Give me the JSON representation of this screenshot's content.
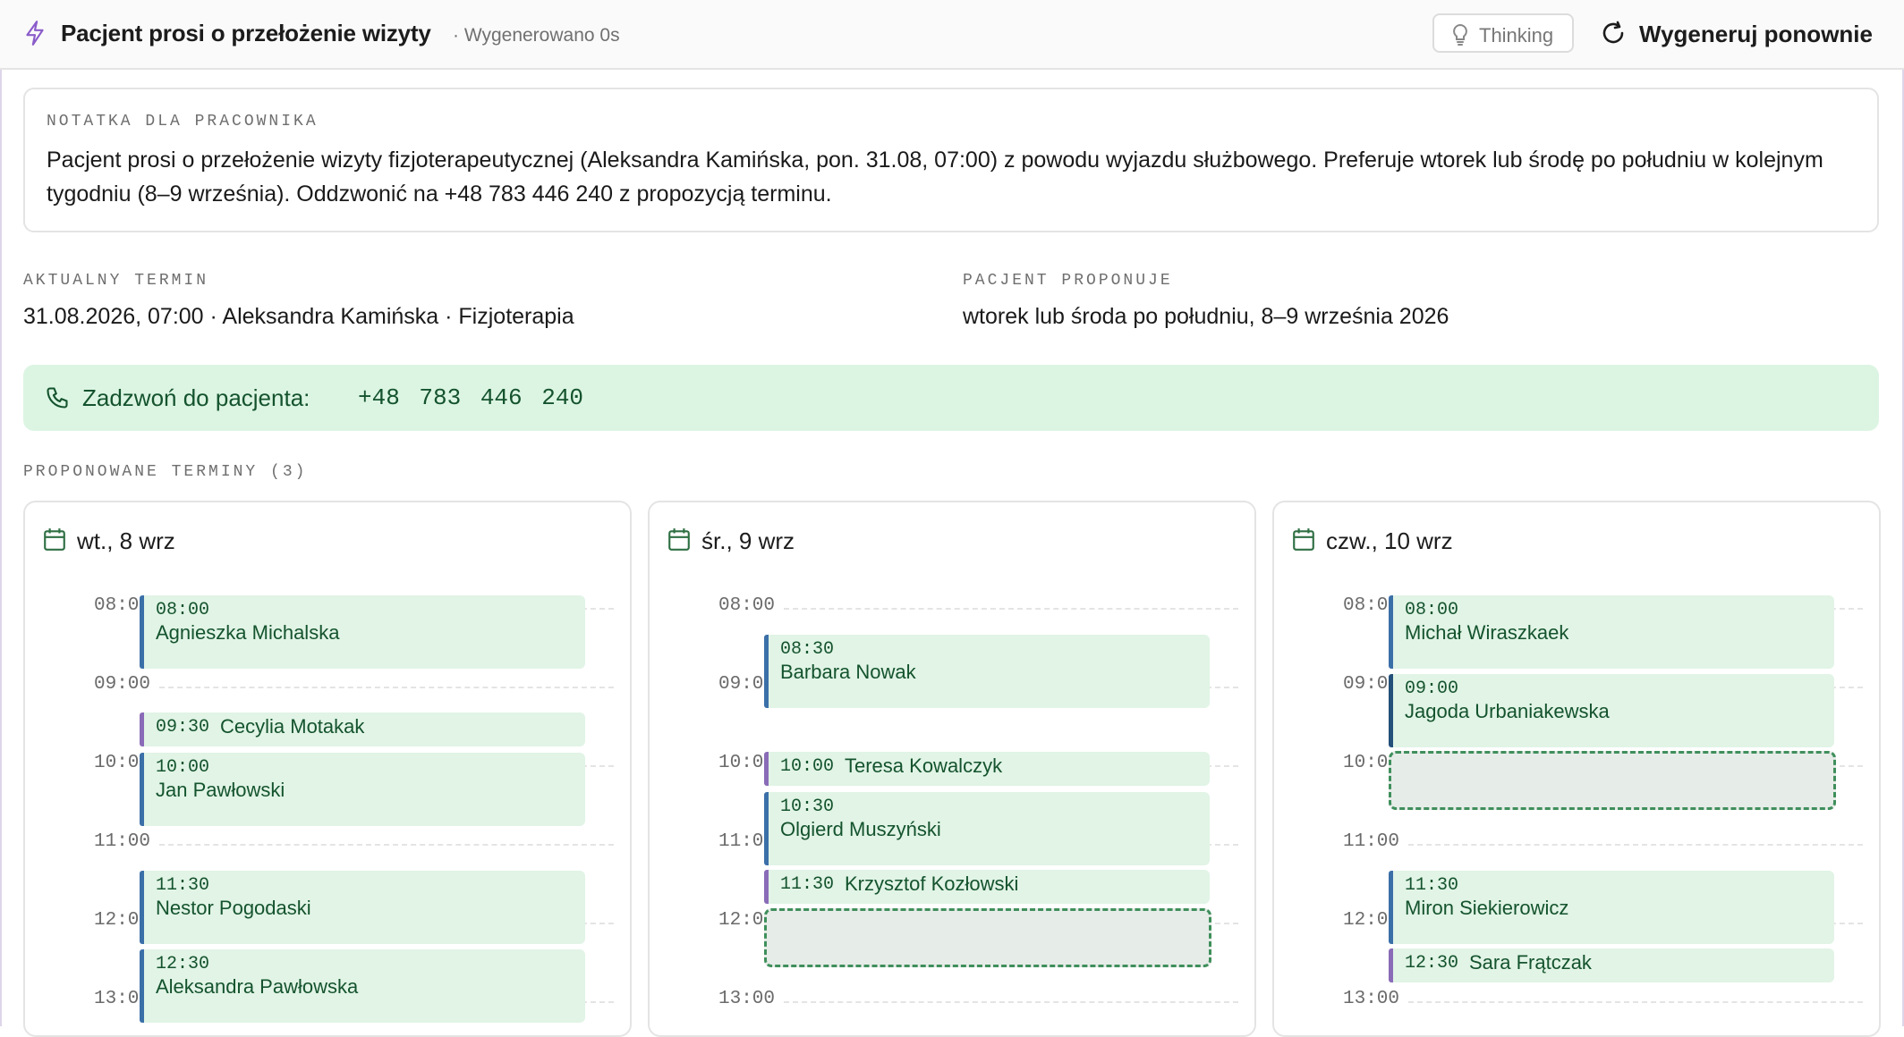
{
  "header": {
    "title": "Pacjent prosi o przełożenie wizyty",
    "generated": "· Wygenerowano 0s",
    "thinking_label": "Thinking",
    "regenerate_label": "Wygeneruj ponownie"
  },
  "note": {
    "label": "NOTATKA DLA PRACOWNIKA",
    "text": "Pacjent prosi o przełożenie wizyty fizjoterapeutycznej (Aleksandra Kamińska, pon. 31.08, 07:00) z powodu wyjazdu służbowego. Preferuje wtorek lub środę po południu w kolejnym tygodniu (8–9 września). Oddzwonić na +48 783 446 240 z propozycją terminu."
  },
  "current": {
    "label": "AKTUALNY TERMIN",
    "value": "31.08.2026, 07:00 · Aleksandra Kamińska · Fizjoterapia"
  },
  "proposed_by_patient": {
    "label": "PACJENT PROPONUJE",
    "value": "wtorek lub środa po południu, 8–9 września 2026"
  },
  "call": {
    "label": "Zadzwoń do pacjenta:",
    "number": "+48 783 446 240"
  },
  "slots_label": "PROPONOWANE TERMINY (3)",
  "hours": [
    "08:00",
    "09:00",
    "10:00",
    "11:00",
    "12:00",
    "13:00"
  ],
  "colors": {
    "event_bg": "#e1f4e6",
    "bar_blue": "#3b6fa8",
    "bar_purple": "#8a6bb8",
    "bar_navy": "#24507a",
    "call_bg": "#dcf5e3",
    "accent_green": "#14532d"
  },
  "days": [
    {
      "title": "wt., 8 wrz",
      "events": [
        {
          "time": "08:00",
          "name": "Agnieszka Michalska"
        },
        {
          "time": "09:30",
          "name": "Cecylia Motakak"
        },
        {
          "time": "10:00",
          "name": "Jan Pawłowski"
        },
        {
          "time": "11:30",
          "name": "Nestor Pogodaski"
        },
        {
          "time": "12:30",
          "name": "Aleksandra Pawłowska"
        }
      ]
    },
    {
      "title": "śr., 9 wrz",
      "events": [
        {
          "time": "08:30",
          "name": "Barbara Nowak"
        },
        {
          "time": "10:00",
          "name": "Teresa Kowalczyk"
        },
        {
          "time": "10:30",
          "name": "Olgierd Muszyński"
        },
        {
          "time": "11:30",
          "name": "Krzysztof Kozłowski"
        }
      ]
    },
    {
      "title": "czw., 10 wrz",
      "events": [
        {
          "time": "08:00",
          "name": "Michał Wiraszkaek"
        },
        {
          "time": "09:00",
          "name": "Jagoda Urbaniakewska"
        },
        {
          "time": "11:30",
          "name": "Miron Siekierowicz"
        },
        {
          "time": "12:30",
          "name": "Sara Frątczak"
        }
      ]
    }
  ]
}
